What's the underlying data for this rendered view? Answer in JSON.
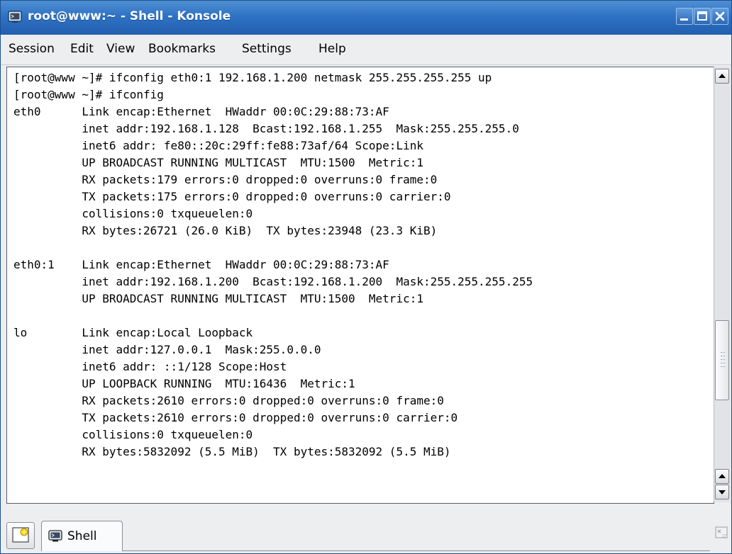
{
  "window": {
    "title": "root@www:~ - Shell - Konsole",
    "accent": "#2e72c4"
  },
  "menubar": {
    "items": [
      "Session",
      "Edit",
      "View",
      "Bookmarks",
      "Settings",
      "Help"
    ]
  },
  "terminal": {
    "lines": [
      "[root@www ~]# ifconfig eth0:1 192.168.1.200 netmask 255.255.255.255 up",
      "[root@www ~]# ifconfig",
      "eth0      Link encap:Ethernet  HWaddr 00:0C:29:88:73:AF",
      "          inet addr:192.168.1.128  Bcast:192.168.1.255  Mask:255.255.255.0",
      "          inet6 addr: fe80::20c:29ff:fe88:73af/64 Scope:Link",
      "          UP BROADCAST RUNNING MULTICAST  MTU:1500  Metric:1",
      "          RX packets:179 errors:0 dropped:0 overruns:0 frame:0",
      "          TX packets:175 errors:0 dropped:0 overruns:0 carrier:0",
      "          collisions:0 txqueuelen:0",
      "          RX bytes:26721 (26.0 KiB)  TX bytes:23948 (23.3 KiB)",
      "",
      "eth0:1    Link encap:Ethernet  HWaddr 00:0C:29:88:73:AF",
      "          inet addr:192.168.1.200  Bcast:192.168.1.200  Mask:255.255.255.255",
      "          UP BROADCAST RUNNING MULTICAST  MTU:1500  Metric:1",
      "",
      "lo        Link encap:Local Loopback",
      "          inet addr:127.0.0.1  Mask:255.0.0.0",
      "          inet6 addr: ::1/128 Scope:Host",
      "          UP LOOPBACK RUNNING  MTU:16436  Metric:1",
      "          RX packets:2610 errors:0 dropped:0 overruns:0 frame:0",
      "          TX packets:2610 errors:0 dropped:0 overruns:0 carrier:0",
      "          collisions:0 txqueuelen:0",
      "          RX bytes:5832092 (5.5 MiB)  TX bytes:5832092 (5.5 MiB)"
    ]
  },
  "tabs": [
    {
      "label": "Shell",
      "icon": "terminal-icon",
      "active": true
    }
  ],
  "icons": {
    "title": "terminal-icon",
    "new_tab": "new-tab-icon",
    "close_tab": "close-tab-icon",
    "minimize": "minimize-icon",
    "maximize": "maximize-icon",
    "close": "close-icon"
  }
}
